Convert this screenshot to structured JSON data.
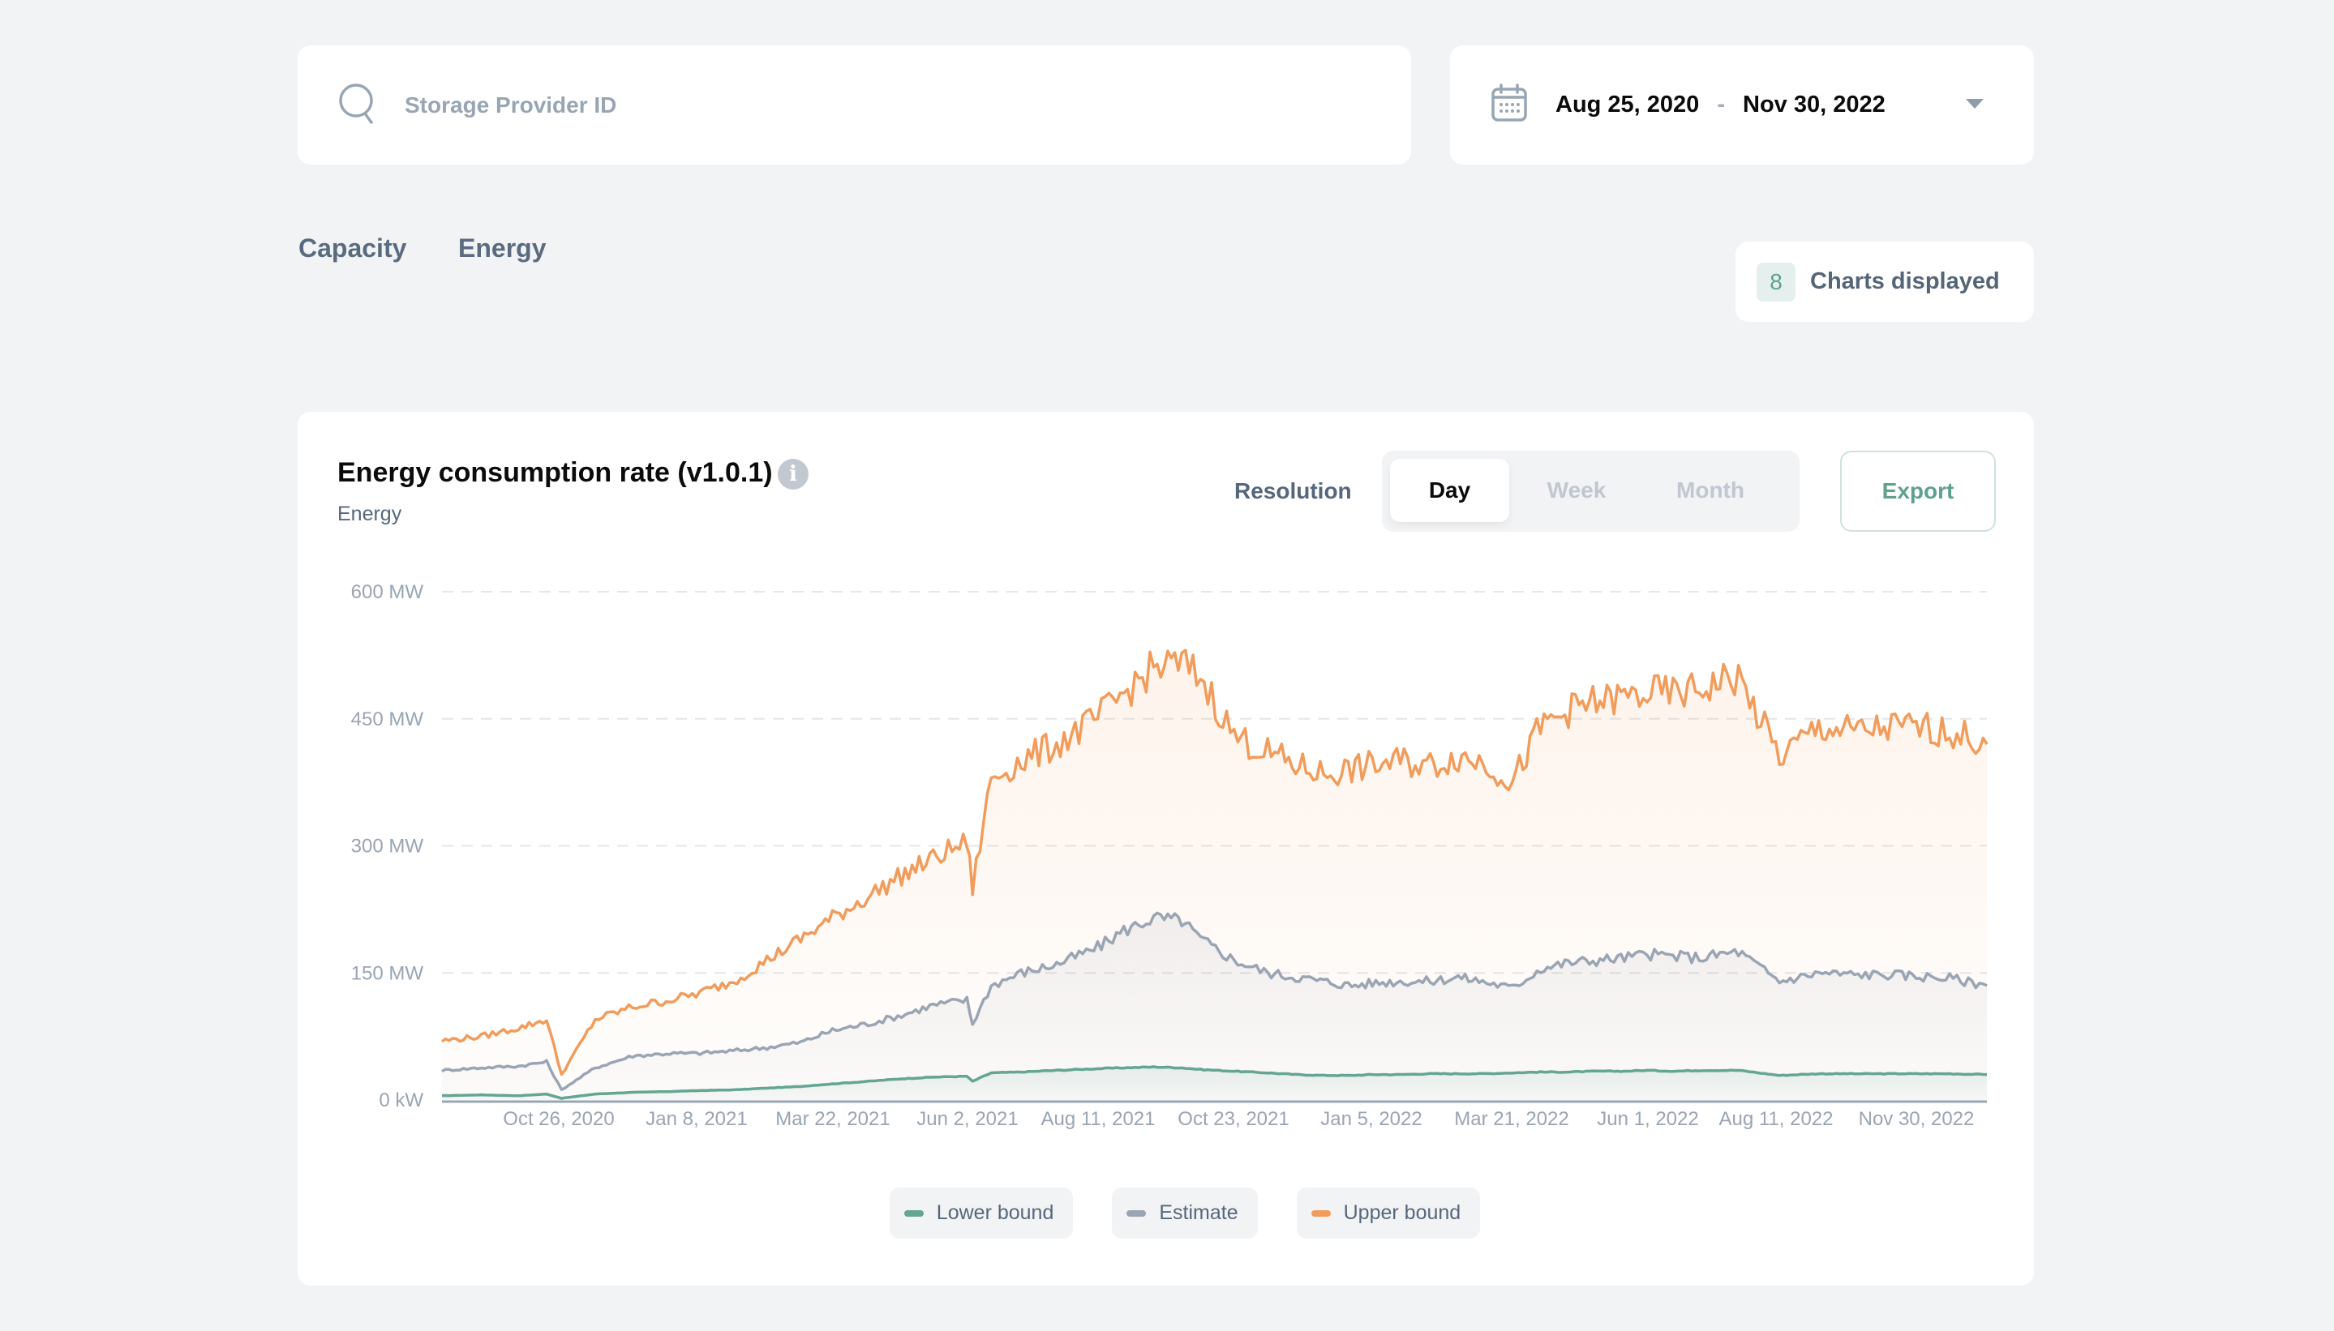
{
  "search": {
    "placeholder": "Storage Provider ID",
    "value": ""
  },
  "date_range": {
    "start": "Aug 25, 2020",
    "separator": "-",
    "end": "Nov 30, 2022"
  },
  "tabs": [
    {
      "label": "Capacity"
    },
    {
      "label": "Energy"
    }
  ],
  "charts_count": {
    "count": "8",
    "label": "Charts displayed"
  },
  "chart_card": {
    "title": "Energy consumption rate (v1.0.1)",
    "subtitle": "Energy",
    "info_icon": "info-icon",
    "resolution_label": "Resolution",
    "resolution_options": [
      "Day",
      "Week",
      "Month"
    ],
    "resolution_selected": "Day",
    "export_label": "Export"
  },
  "colors": {
    "lower_bound": "#64a593",
    "estimate": "#9aa5b3",
    "upper_bound": "#f29c5c",
    "accent": "#5fa08e",
    "background": "#f2f3f5"
  },
  "chart_data": {
    "type": "area",
    "title": "Energy consumption rate (v1.0.1)",
    "subtitle": "Energy",
    "xlabel": "",
    "ylabel": "",
    "y_unit": "MW",
    "ylim": [
      0,
      600
    ],
    "y_ticks": [
      0,
      150,
      300,
      450,
      600
    ],
    "y_tick_labels": [
      "0 kW",
      "150 MW",
      "300 MW",
      "450 MW",
      "600 MW"
    ],
    "x_range": [
      "2020-08-25",
      "2022-11-30"
    ],
    "x_tick_labels": [
      "Oct 26, 2020",
      "Jan 8, 2021",
      "Mar 22, 2021",
      "Jun 2, 2021",
      "Aug 11, 2021",
      "Oct 23, 2021",
      "Jan 5, 2022",
      "Mar 21, 2022",
      "Jun 1, 2022",
      "Aug 11, 2022",
      "Nov 30, 2022"
    ],
    "grid": true,
    "legend_position": "bottom-center",
    "x": [
      "2020-08-25",
      "2020-09-15",
      "2020-10-05",
      "2020-10-20",
      "2020-10-28",
      "2020-11-15",
      "2020-12-05",
      "2020-12-25",
      "2021-01-08",
      "2021-01-28",
      "2021-02-15",
      "2021-03-05",
      "2021-03-22",
      "2021-04-10",
      "2021-04-28",
      "2021-05-15",
      "2021-06-02",
      "2021-06-05",
      "2021-06-15",
      "2021-07-01",
      "2021-07-20",
      "2021-08-11",
      "2021-08-25",
      "2021-09-10",
      "2021-09-25",
      "2021-10-05",
      "2021-10-23",
      "2021-11-10",
      "2021-11-25",
      "2021-12-10",
      "2021-12-25",
      "2022-01-05",
      "2022-01-20",
      "2022-02-05",
      "2022-02-20",
      "2022-03-05",
      "2022-03-21",
      "2022-04-05",
      "2022-04-20",
      "2022-05-05",
      "2022-05-20",
      "2022-06-01",
      "2022-06-15",
      "2022-07-01",
      "2022-07-10",
      "2022-07-20",
      "2022-08-11",
      "2022-09-01",
      "2022-09-20",
      "2022-10-10",
      "2022-10-25",
      "2022-11-10",
      "2022-11-30"
    ],
    "series": [
      {
        "name": "Lower bound",
        "color": "#64a593",
        "values": [
          5,
          6,
          5,
          7,
          2,
          7,
          9,
          10,
          11,
          12,
          14,
          16,
          19,
          22,
          25,
          27,
          28,
          22,
          32,
          33,
          35,
          37,
          38,
          39,
          38,
          36,
          34,
          32,
          30,
          29,
          29,
          30,
          30,
          31,
          31,
          31,
          32,
          33,
          33,
          34,
          34,
          35,
          34,
          35,
          35,
          35,
          29,
          31,
          31,
          31,
          31,
          31,
          30
        ]
      },
      {
        "name": "Estimate",
        "color": "#9aa5b3",
        "values": [
          35,
          38,
          40,
          45,
          12,
          38,
          52,
          55,
          55,
          58,
          62,
          68,
          82,
          90,
          100,
          112,
          118,
          90,
          135,
          150,
          160,
          180,
          200,
          215,
          212,
          190,
          165,
          150,
          145,
          140,
          135,
          138,
          140,
          140,
          145,
          140,
          132,
          155,
          162,
          165,
          168,
          172,
          170,
          168,
          172,
          175,
          140,
          150,
          148,
          148,
          146,
          144,
          135
        ]
      },
      {
        "name": "Upper bound",
        "color": "#f29c5c",
        "values": [
          70,
          75,
          85,
          95,
          30,
          95,
          110,
          118,
          125,
          140,
          165,
          190,
          215,
          240,
          265,
          285,
          305,
          250,
          380,
          400,
          420,
          450,
          480,
          510,
          515,
          500,
          430,
          410,
          395,
          385,
          390,
          395,
          400,
          395,
          405,
          400,
          375,
          440,
          460,
          470,
          475,
          480,
          480,
          485,
          495,
          498,
          405,
          440,
          435,
          440,
          440,
          435,
          420
        ]
      }
    ]
  }
}
